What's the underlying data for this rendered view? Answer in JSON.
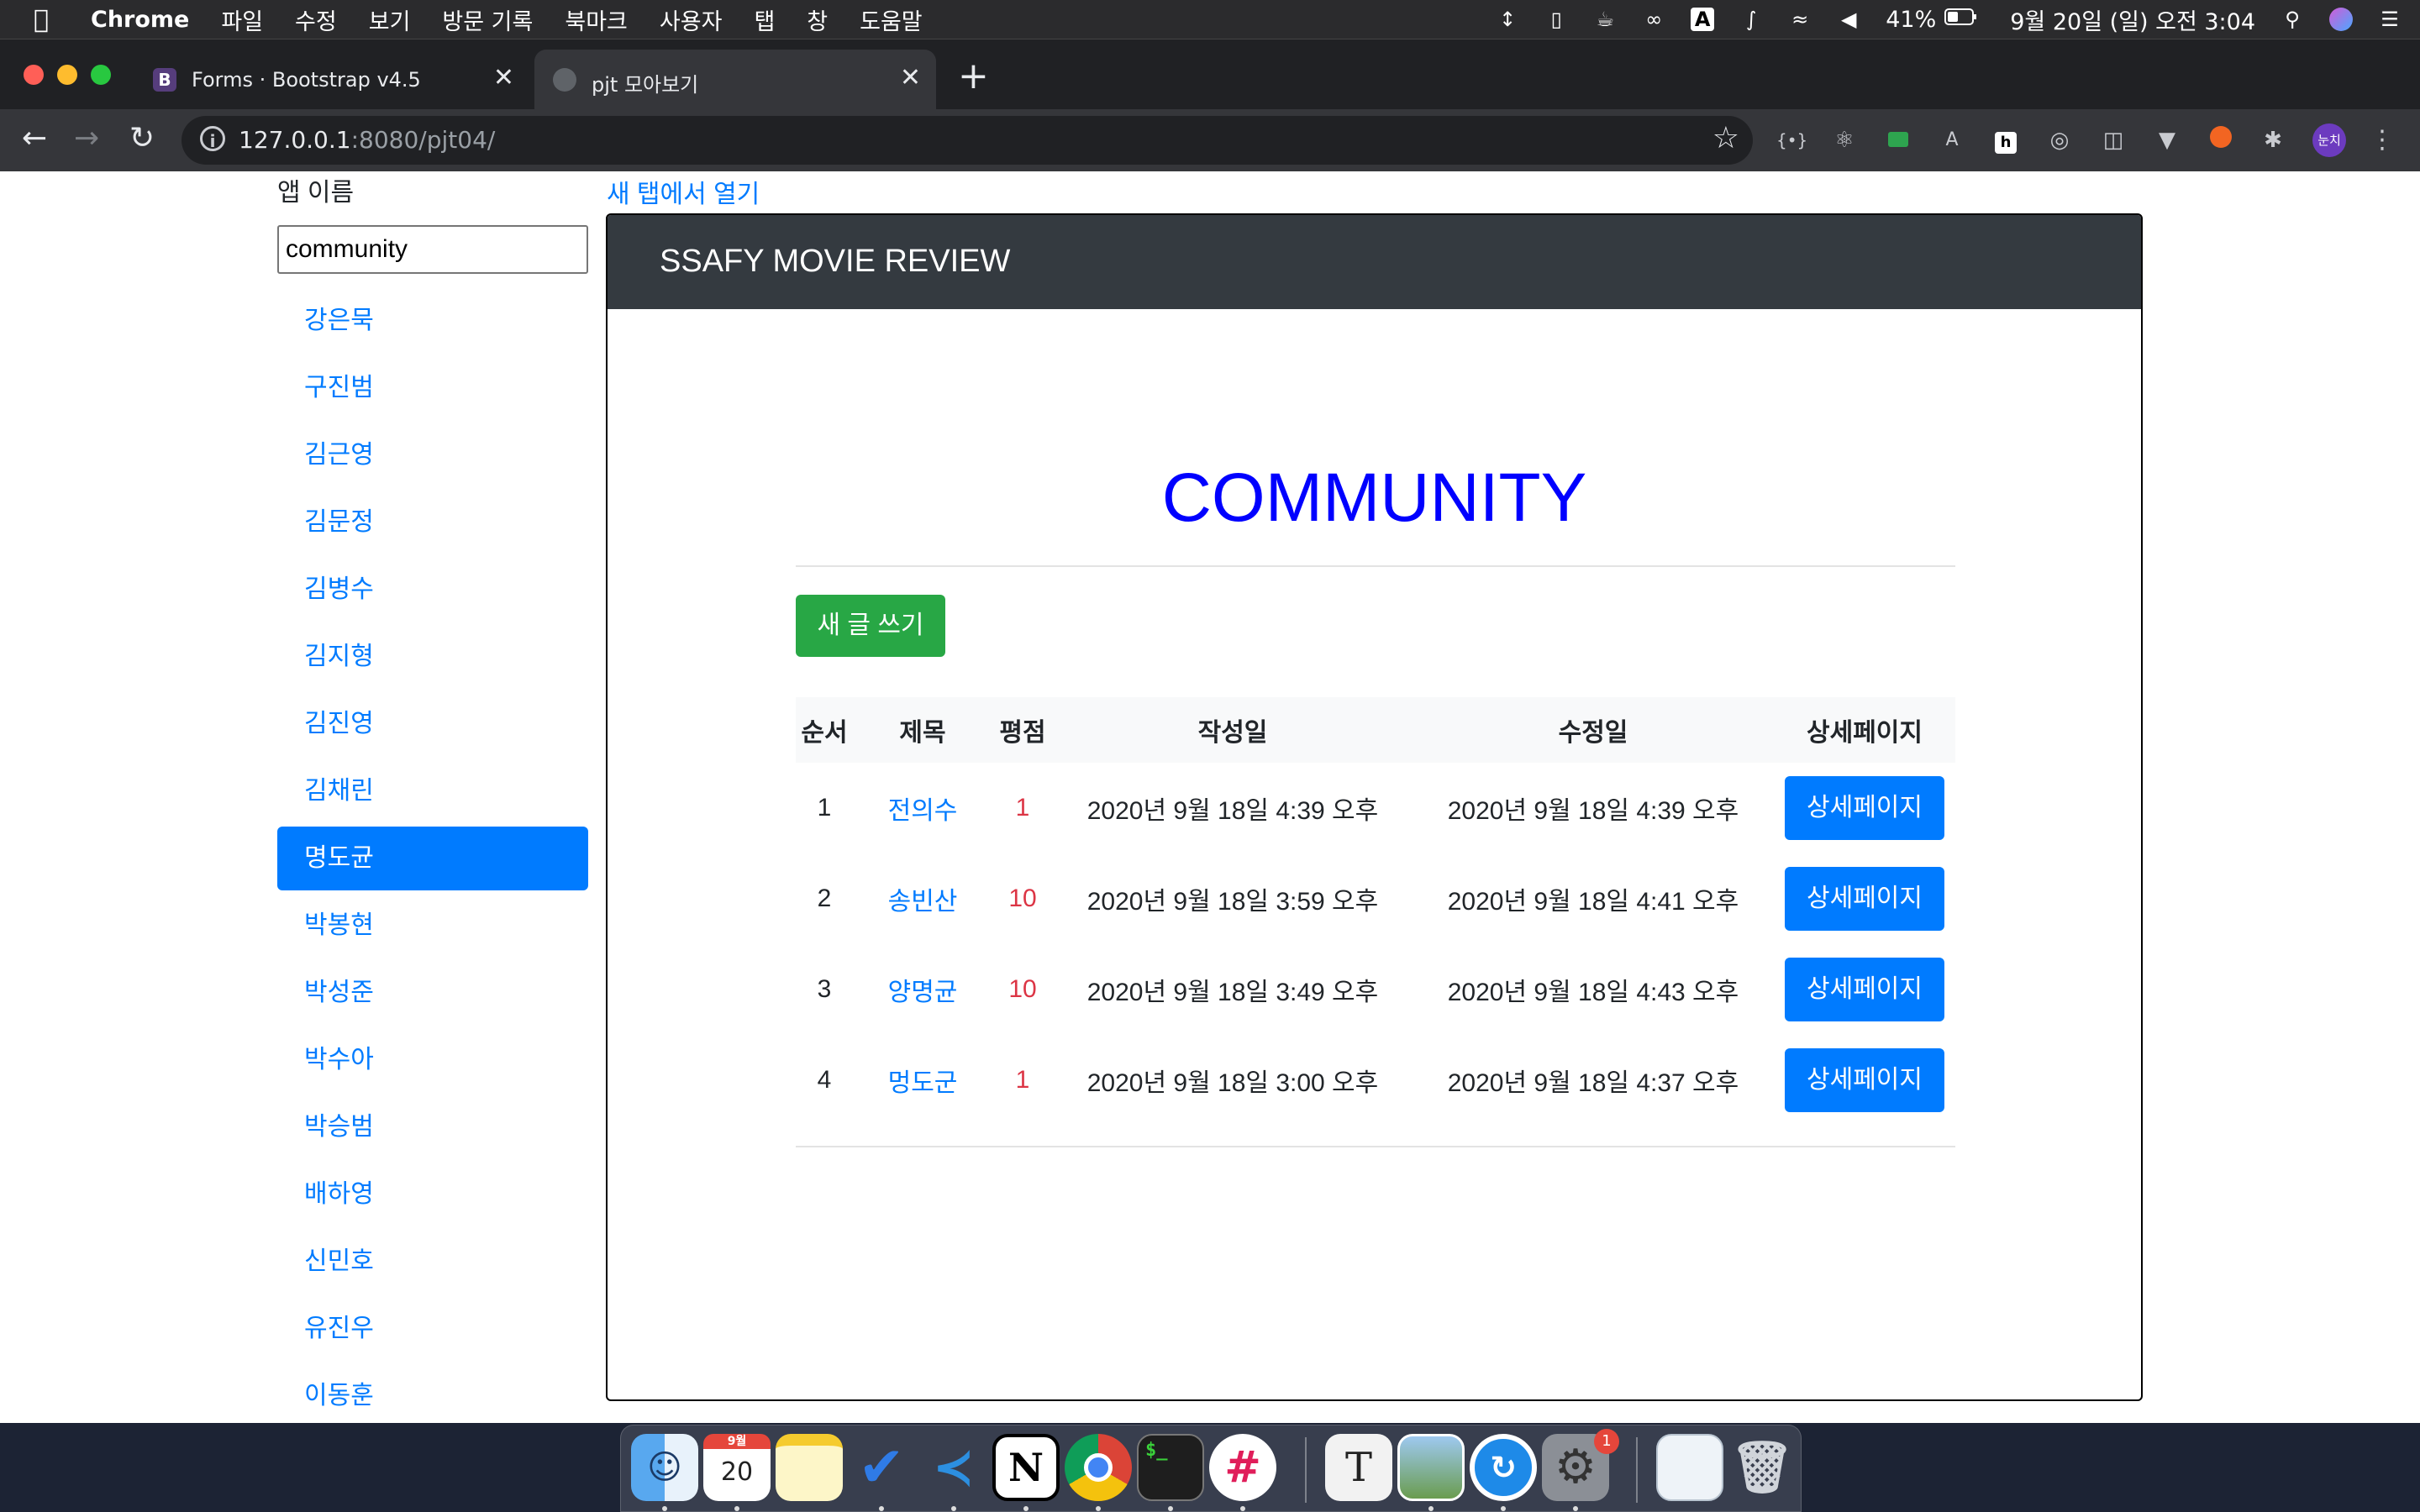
{
  "menubar": {
    "app_name": "Chrome",
    "menus": [
      "파일",
      "수정",
      "보기",
      "방문 기록",
      "북마크",
      "사용자",
      "탭",
      "창",
      "도움말"
    ],
    "battery": "41%",
    "datetime": "9월 20일 (일) 오전 3:04",
    "status_icons": [
      "sort-arrows-icon",
      "tablet-icon",
      "coffee-icon",
      "glasses-icon",
      "input-a-icon",
      "bluetooth-icon",
      "wifi-icon",
      "volume-icon",
      "battery-icon",
      "spotlight-icon",
      "siri-icon",
      "control-center-icon"
    ]
  },
  "browser": {
    "tabs": [
      {
        "label": "Forms · Bootstrap v4.5",
        "favicon": "B",
        "active": false
      },
      {
        "label": "pjt 모아보기",
        "favicon": "globe-icon",
        "active": true
      }
    ],
    "url_host": "127.0.0.1",
    "url_rest": ":8080/pjt04/",
    "profile_label": "눈치",
    "extensions": [
      "json-icon",
      "react-icon",
      "green-ext-icon",
      "text-ext-icon",
      "hypothesis-icon",
      "target-icon",
      "trello-icon",
      "vue-icon",
      "orange-ext-icon",
      "puzzle-icon"
    ]
  },
  "sidebar": {
    "app_label": "앱 이름",
    "app_input_value": "community",
    "names": [
      "강은묵",
      "구진범",
      "김근영",
      "김문정",
      "김병수",
      "김지형",
      "김진영",
      "김채린",
      "명도균",
      "박봉현",
      "박성준",
      "박수아",
      "박승범",
      "배하영",
      "신민호",
      "유진우",
      "이동훈"
    ],
    "active_index": 8
  },
  "main": {
    "open_new_tab": "새 탭에서 열기",
    "navbar_brand": "SSAFY MOVIE REVIEW",
    "page_title": "COMMUNITY",
    "write_button": "새 글 쓰기",
    "table": {
      "headers": [
        "순서",
        "제목",
        "평점",
        "작성일",
        "수정일",
        "상세페이지"
      ],
      "rows": [
        {
          "no": "1",
          "title": "전의수",
          "score": "1",
          "created": "2020년 9월 18일 4:39 오후",
          "updated": "2020년 9월 18일 4:39 오후",
          "detail": "상세페이지"
        },
        {
          "no": "2",
          "title": "송빈산",
          "score": "10",
          "created": "2020년 9월 18일 3:59 오후",
          "updated": "2020년 9월 18일 4:41 오후",
          "detail": "상세페이지"
        },
        {
          "no": "3",
          "title": "양명균",
          "score": "10",
          "created": "2020년 9월 18일 3:49 오후",
          "updated": "2020년 9월 18일 4:43 오후",
          "detail": "상세페이지"
        },
        {
          "no": "4",
          "title": "멍도군",
          "score": "1",
          "created": "2020년 9월 18일 3:00 오후",
          "updated": "2020년 9월 18일 4:37 오후",
          "detail": "상세페이지"
        }
      ]
    }
  },
  "dock": {
    "apps": [
      "finder-icon",
      "calendar-icon",
      "notes-icon",
      "todo-icon",
      "vscode-icon",
      "notion-icon",
      "chrome-icon",
      "terminal-icon",
      "slack-icon",
      "typora-icon",
      "preview-icon",
      "transmit-icon",
      "system-preferences-icon",
      "document-icon",
      "trash-icon"
    ],
    "calendar_month": "9월",
    "calendar_day": "20",
    "notion_letter": "N",
    "typora_letter": "T",
    "terminal_text": "$_",
    "settings_badge": "1"
  },
  "colors": {
    "primary": "#007bff",
    "success": "#28a745",
    "danger": "#dc3545",
    "title_blue": "#0000ff",
    "navbar": "#343a40"
  }
}
